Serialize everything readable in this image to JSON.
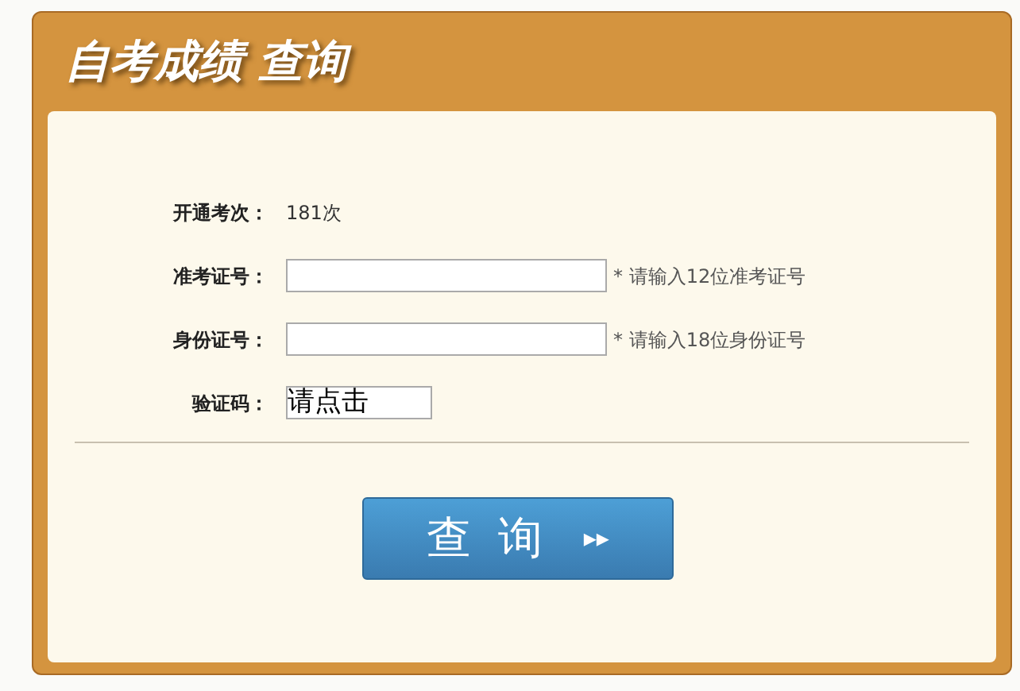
{
  "header": {
    "title": "自考成绩 查询"
  },
  "rows": [
    {
      "kind": "text",
      "label": "开通考次：",
      "value": "181次"
    },
    {
      "kind": "input",
      "label": "准考证号：",
      "hint": "* 请输入12位准考证号"
    },
    {
      "kind": "input",
      "label": "身份证号：",
      "hint": "* 请输入18位身份证号"
    },
    {
      "kind": "captcha",
      "label": "验证码：",
      "value": "请点击"
    }
  ],
  "button": {
    "label": "查询",
    "icon": "▸▸"
  }
}
